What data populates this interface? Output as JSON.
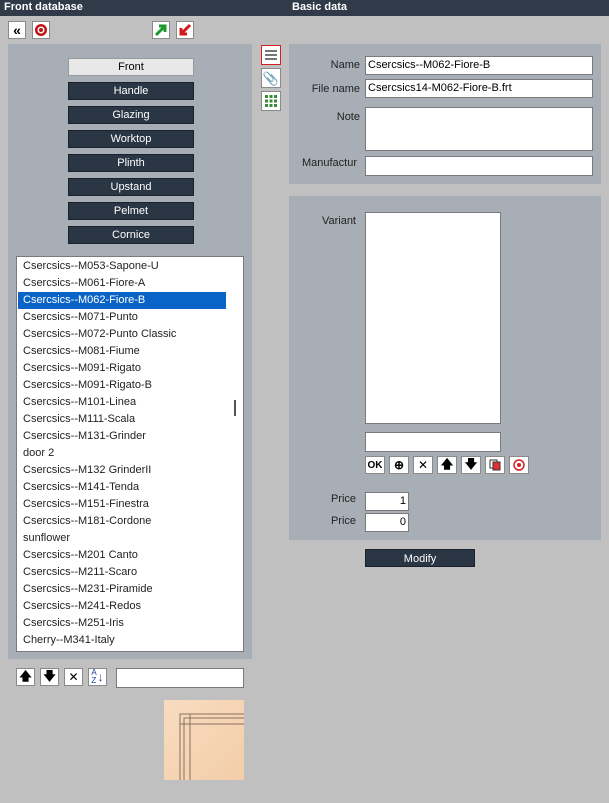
{
  "titlebar": {
    "left_title": "Front database",
    "right_title": "Basic data"
  },
  "toolbar": {
    "back_icon": "double-chevron-left-icon",
    "help_icon": "lifebuoy-icon",
    "export_icon": "green-arrow-up-right-icon",
    "import_icon": "red-arrow-down-left-icon"
  },
  "categories": [
    "Front",
    "Handle",
    "Glazing",
    "Worktop",
    "Plinth",
    "Upstand",
    "Pelmet",
    "Cornice"
  ],
  "active_category": "Front",
  "list": {
    "items": [
      "Csercsics--M053-Sapone-U",
      "Csercsics--M061-Fiore-A",
      "Csercsics--M062-Fiore-B",
      "Csercsics--M071-Punto",
      "Csercsics--M072-Punto Classic",
      "Csercsics--M081-Fiume",
      "Csercsics--M091-Rigato",
      "Csercsics--M091-Rigato-B",
      "Csercsics--M101-Linea",
      "Csercsics--M111-Scala",
      "Csercsics--M131-Grinder",
      "door 2",
      "Csercsics--M132 GrinderII",
      "Csercsics--M141-Tenda",
      "Csercsics--M151-Finestra",
      "Csercsics--M181-Cordone",
      "sunflower",
      "Csercsics--M201 Canto",
      "Csercsics--M211-Scaro",
      "Csercsics--M231-Piramide",
      "Csercsics--M241-Redos",
      "Csercsics--M251-Iris",
      "Cherry--M341-Italy"
    ],
    "selected": "Csercsics--M062-Fiore-B",
    "search_value": ""
  },
  "basic": {
    "name_label": "Name",
    "name_value": "Csercsics--M062-Fiore-B",
    "filename_label": "File name",
    "filename_value": "Csercsics14-M062-Fiore-B.frt",
    "note_label": "Note",
    "note_value": "",
    "manufacturer_label": "Manufactur",
    "manufacturer_value": ""
  },
  "variant": {
    "label": "Variant",
    "input_value": "",
    "ok_label": "OK",
    "price_label_1": "Price",
    "price_value_1": "1",
    "price_label_2": "Price",
    "price_value_2": "0"
  },
  "modify_label": "Modify",
  "sort_label_a": "A",
  "sort_label_z": "Z",
  "colors": {
    "titlebar": "#303a48",
    "selected": "#0a64c8",
    "button_dark": "#2a3644"
  }
}
